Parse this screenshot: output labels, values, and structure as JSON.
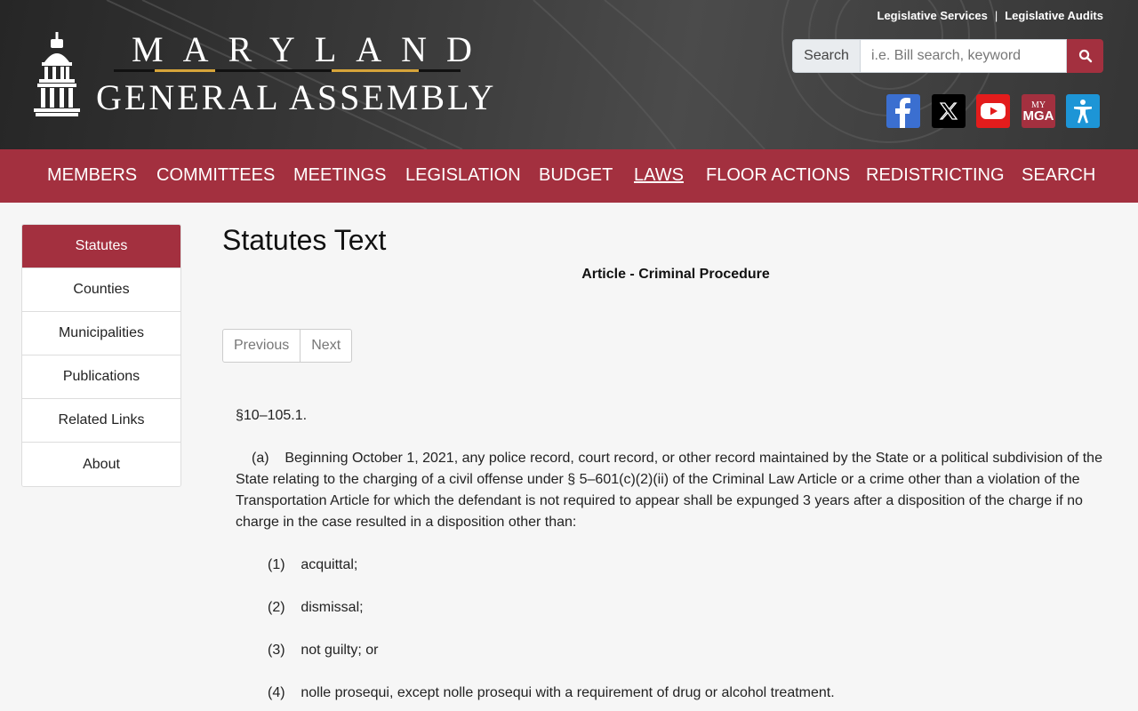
{
  "header": {
    "top_links": [
      "Legislative Services",
      "Legislative Audits"
    ],
    "top_links_separator": "|",
    "logo_line1": "MARYLAND",
    "logo_line2": "GENERAL ASSEMBLY",
    "search": {
      "label": "Search",
      "placeholder": "i.e. Bill search, keyword"
    },
    "social": {
      "mga_label_top": "MY",
      "mga_label_bottom": "MGA"
    }
  },
  "nav": {
    "items": [
      "MEMBERS",
      "COMMITTEES",
      "MEETINGS",
      "LEGISLATION",
      "BUDGET",
      "LAWS",
      "FLOOR ACTIONS",
      "REDISTRICTING",
      "SEARCH"
    ],
    "active": "LAWS"
  },
  "sidebar": {
    "items": [
      "Statutes",
      "Counties",
      "Municipalities",
      "Publications",
      "Related Links",
      "About"
    ],
    "active": "Statutes"
  },
  "main": {
    "title": "Statutes Text",
    "article": "Article - Criminal Procedure",
    "pager": {
      "previous": "Previous",
      "next": "Next"
    },
    "section": "§10–105.1.",
    "paragraph_a": "(a)    Beginning October 1, 2021, any police record, court record, or other record maintained by the State or a political subdivision of the State relating to the charging of a civil offense under § 5–601(c)(2)(ii) of the Criminal Law Article or a crime other than a violation of the Transportation Article for which the defendant is not required to appear shall be expunged 3 years after a disposition of the charge if no charge in the case resulted in a disposition other than:",
    "items": [
      "(1)    acquittal;",
      "(2)    dismissal;",
      "(3)    not guilty; or",
      "(4)    nolle prosequi, except nolle prosequi with a requirement of drug or alcohol treatment."
    ]
  },
  "colors": {
    "brand": "#a3303f",
    "gold": "#d6a43a",
    "facebook": "#3b6fd0",
    "youtube": "#e31c1c",
    "accessibility": "#1d95d6"
  }
}
